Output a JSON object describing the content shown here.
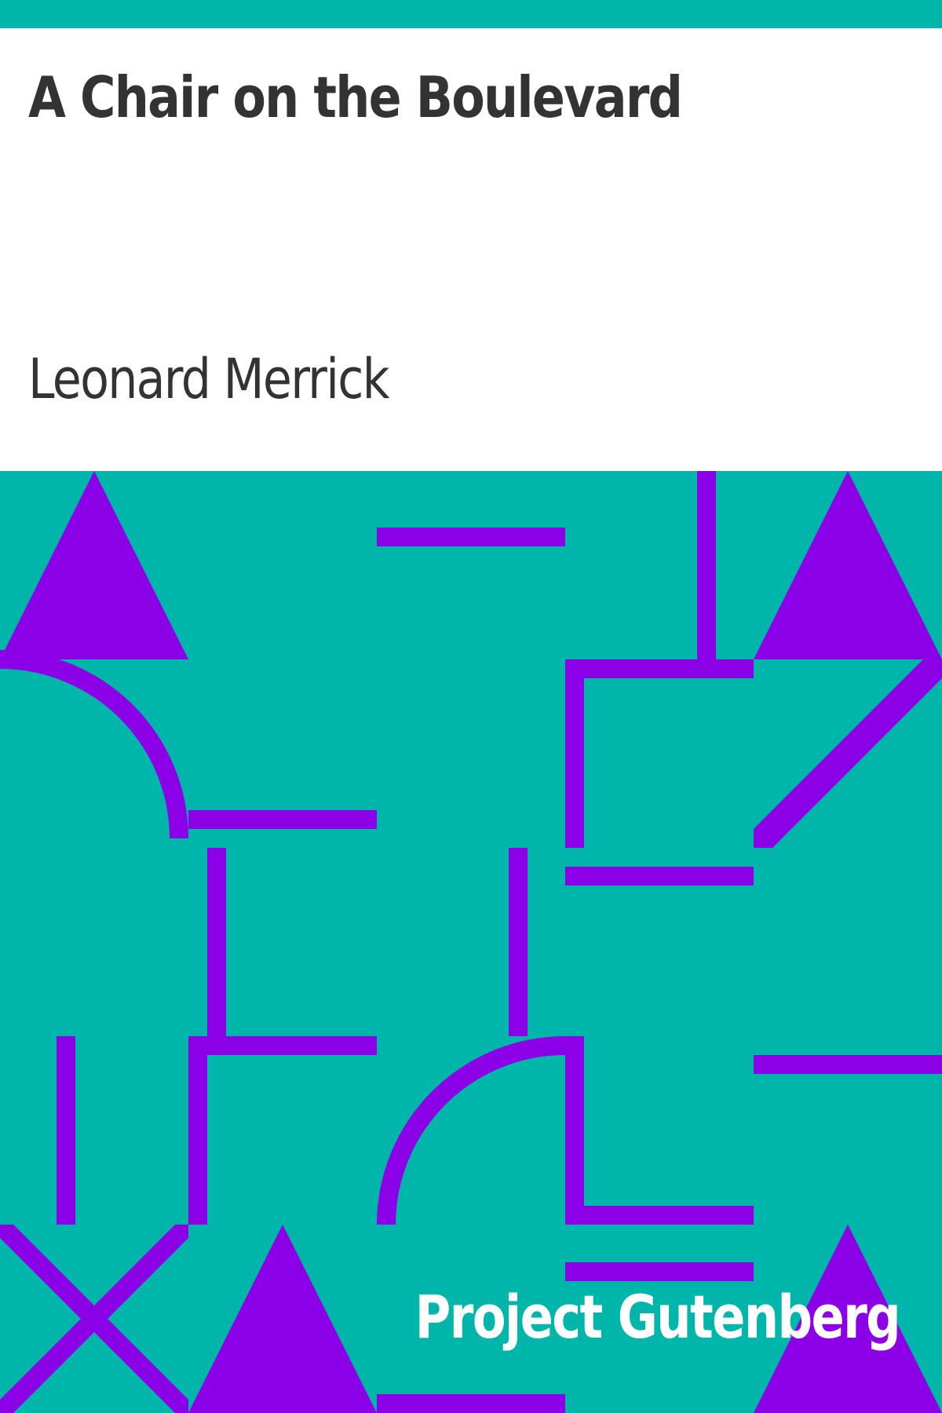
{
  "colors": {
    "teal": "#00b5a9",
    "purple": "#8b00e6",
    "text_dark": "#333333",
    "publisher_text": "#ffffff",
    "background": "#ffffff"
  },
  "cover": {
    "title": "A Chair on the Boulevard",
    "author": "Leonard Merrick",
    "publisher": "Project Gutenberg"
  }
}
